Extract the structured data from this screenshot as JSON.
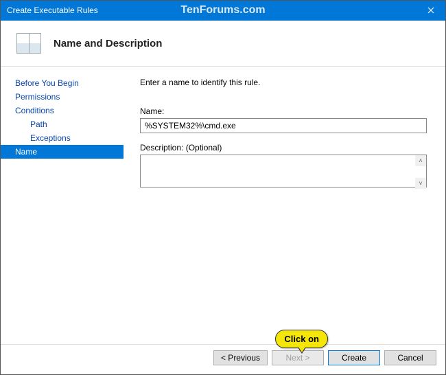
{
  "window": {
    "title": "Create Executable Rules"
  },
  "watermark": "TenForums.com",
  "header": {
    "title": "Name and Description"
  },
  "sidebar": {
    "items": [
      {
        "label": "Before You Begin",
        "indent": false,
        "selected": false
      },
      {
        "label": "Permissions",
        "indent": false,
        "selected": false
      },
      {
        "label": "Conditions",
        "indent": false,
        "selected": false
      },
      {
        "label": "Path",
        "indent": true,
        "selected": false
      },
      {
        "label": "Exceptions",
        "indent": true,
        "selected": false
      },
      {
        "label": "Name",
        "indent": false,
        "selected": true
      }
    ]
  },
  "content": {
    "instruction": "Enter a name to identify this rule.",
    "name_label": "Name:",
    "name_value": "%SYSTEM32%\\cmd.exe",
    "desc_label": "Description: (Optional)",
    "desc_value": ""
  },
  "buttons": {
    "previous": "< Previous",
    "next": "Next >",
    "create": "Create",
    "cancel": "Cancel"
  },
  "callout": {
    "text": "Click on"
  }
}
